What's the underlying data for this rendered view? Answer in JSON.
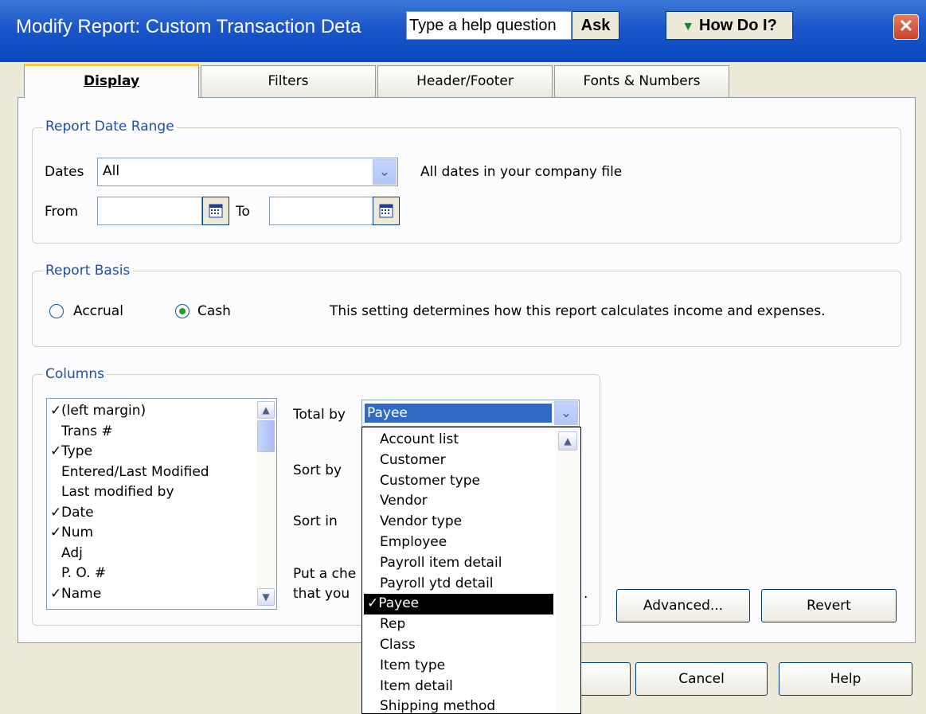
{
  "window": {
    "title": "Modify Report: Custom Transaction Deta",
    "help_placeholder": "Type a help question",
    "ask_label": "Ask",
    "howdoi_label": "How Do I?",
    "close_glyph": "✕"
  },
  "tabs": [
    {
      "label": "Display",
      "active": true
    },
    {
      "label": "Filters"
    },
    {
      "label": "Header/Footer"
    },
    {
      "label": "Fonts & Numbers"
    }
  ],
  "date_range": {
    "legend": "Report Date Range",
    "dates_label": "Dates",
    "dates_value": "All",
    "description": "All dates in your company file",
    "from_label": "From",
    "from_value": "",
    "to_label": "To",
    "to_value": ""
  },
  "basis": {
    "legend": "Report Basis",
    "accrual_label": "Accrual",
    "cash_label": "Cash",
    "selected": "Cash",
    "description": "This setting determines how this report calculates income and expenses."
  },
  "columns": {
    "legend": "Columns",
    "items": [
      {
        "check": "✓",
        "label": "(left margin)"
      },
      {
        "check": "",
        "label": "Trans #"
      },
      {
        "check": "✓",
        "label": "Type"
      },
      {
        "check": "",
        "label": "Entered/Last Modified"
      },
      {
        "check": "",
        "label": "Last modified by"
      },
      {
        "check": "✓",
        "label": "Date"
      },
      {
        "check": "✓",
        "label": "Num"
      },
      {
        "check": "",
        "label": "Adj"
      },
      {
        "check": "",
        "label": "P. O. #"
      },
      {
        "check": "✓",
        "label": "Name"
      }
    ],
    "total_by_label": "Total by",
    "total_by_value": "Payee",
    "sort_by_label": "Sort by",
    "sort_in_label": "Sort in",
    "hint_line1": "Put a che",
    "hint_line2": "that you",
    "hint_tail": "."
  },
  "total_by_options": [
    {
      "label": "Account list"
    },
    {
      "label": "Customer"
    },
    {
      "label": "Customer type"
    },
    {
      "label": "Vendor"
    },
    {
      "label": "Vendor type"
    },
    {
      "label": "Employee"
    },
    {
      "label": "Payroll item detail"
    },
    {
      "label": "Payroll ytd detail"
    },
    {
      "label": "Payee",
      "selected": true,
      "check": "✓"
    },
    {
      "label": "Rep"
    },
    {
      "label": "Class"
    },
    {
      "label": "Item type"
    },
    {
      "label": "Item detail"
    },
    {
      "label": "Shipping method"
    }
  ],
  "buttons": {
    "advanced": "Advanced...",
    "revert": "Revert",
    "cancel": "Cancel",
    "help": "Help"
  },
  "icons": {
    "dropdown": "chevron-down-icon",
    "calendar": "calendar-icon",
    "scroll_up": "scroll-up-icon",
    "scroll_down": "scroll-down-icon"
  }
}
